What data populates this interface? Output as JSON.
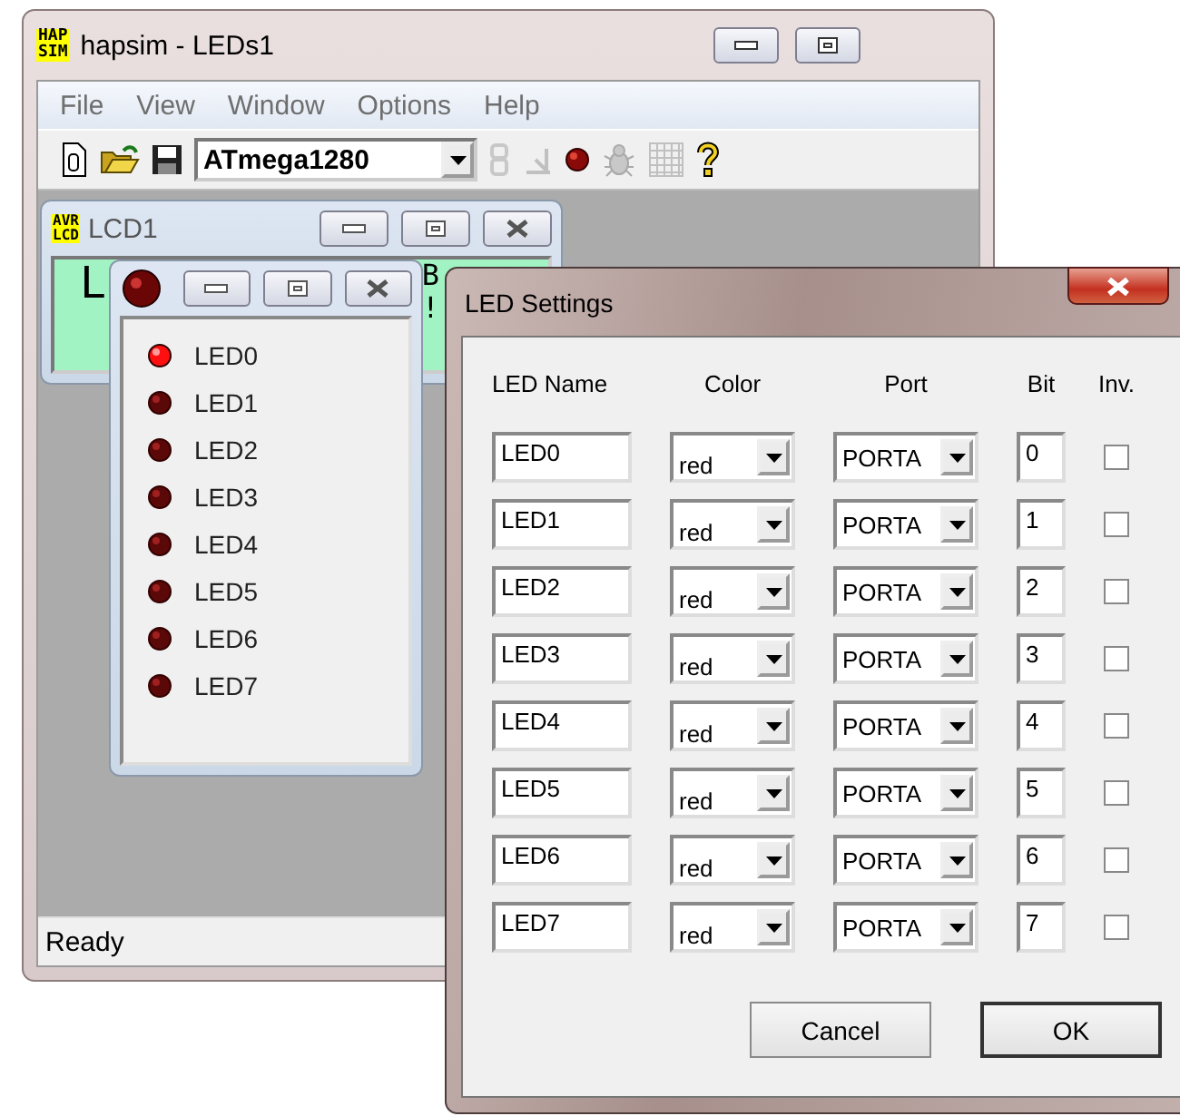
{
  "main_window": {
    "title": "hapsim - LEDs1",
    "logo": [
      "HAP",
      "SIM"
    ],
    "menu": [
      "File",
      "View",
      "Window",
      "Options",
      "Help"
    ],
    "device": "ATmega1280",
    "status": "Ready"
  },
  "lcd_window": {
    "title": "LCD1",
    "logo": [
      "AVR",
      "LCD"
    ],
    "screen_fragments": [
      "L",
      "B",
      "!"
    ]
  },
  "leds_window": {
    "leds": [
      {
        "label": "LED0",
        "on": true
      },
      {
        "label": "LED1",
        "on": false
      },
      {
        "label": "LED2",
        "on": false
      },
      {
        "label": "LED3",
        "on": false
      },
      {
        "label": "LED4",
        "on": false
      },
      {
        "label": "LED5",
        "on": false
      },
      {
        "label": "LED6",
        "on": false
      },
      {
        "label": "LED7",
        "on": false
      }
    ]
  },
  "dialog": {
    "title": "LED Settings",
    "columns": [
      "LED Name",
      "Color",
      "Port",
      "Bit",
      "Inv."
    ],
    "rows": [
      {
        "name": "LED0",
        "color_choice": "red",
        "port": "PORTA",
        "bit": "0",
        "inverted": false
      },
      {
        "name": "LED1",
        "color_choice": "red",
        "port": "PORTA",
        "bit": "1",
        "inverted": false
      },
      {
        "name": "LED2",
        "color_choice": "red",
        "port": "PORTA",
        "bit": "2",
        "inverted": false
      },
      {
        "name": "LED3",
        "color_choice": "red",
        "port": "PORTA",
        "bit": "3",
        "inverted": false
      },
      {
        "name": "LED4",
        "color_choice": "red",
        "port": "PORTA",
        "bit": "4",
        "inverted": false
      },
      {
        "name": "LED5",
        "color_choice": "red",
        "port": "PORTA",
        "bit": "5",
        "inverted": false
      },
      {
        "name": "LED6",
        "color_choice": "red",
        "port": "PORTA",
        "bit": "6",
        "inverted": false
      },
      {
        "name": "LED7",
        "color_choice": "red",
        "port": "PORTA",
        "bit": "7",
        "inverted": false
      }
    ],
    "buttons": [
      "Cancel",
      "OK"
    ]
  }
}
